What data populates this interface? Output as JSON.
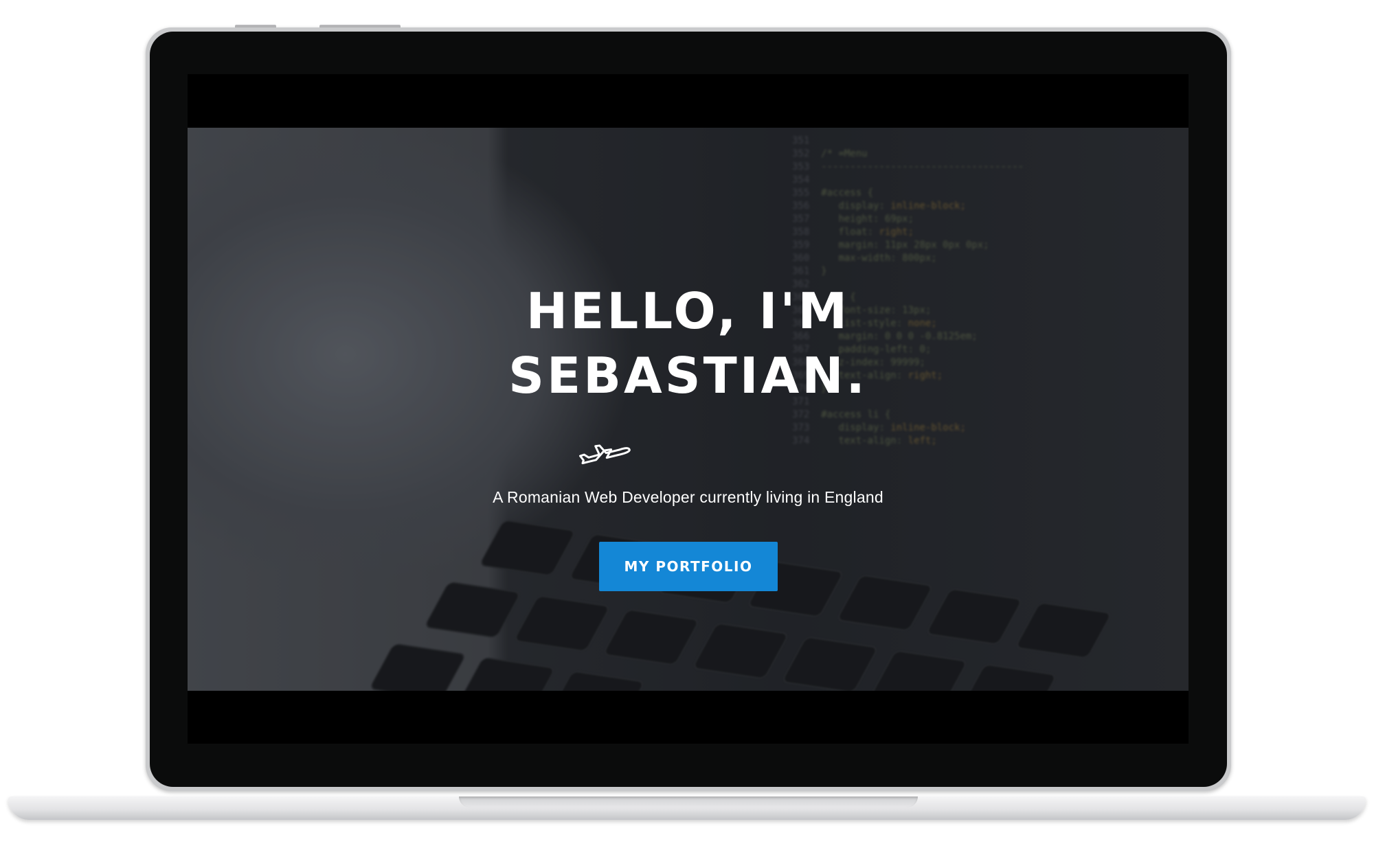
{
  "hero": {
    "title_line1": "HELLO, I'M",
    "title_line2": "SEBASTIAN.",
    "subtitle": "A Romanian Web Developer currently living in England",
    "cta_label": "MY PORTFOLIO"
  },
  "icons": {
    "hero_icon": "airplane-icon"
  },
  "colors": {
    "cta_background": "#1487d6",
    "text": "#ffffff"
  }
}
